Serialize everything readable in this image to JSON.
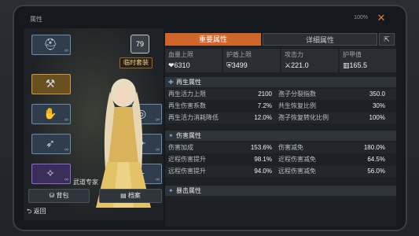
{
  "title": "属性",
  "battery": "100%",
  "level": "79",
  "temp_suit": "临时套装",
  "expert": "武道专家",
  "buttons": {
    "bag": "背包",
    "archive": "档案",
    "back": "返回"
  },
  "tabs": [
    "重要属性",
    "详细属性"
  ],
  "top_stats": [
    {
      "label": "血量上限",
      "value": "6310",
      "icon": "heart-icon"
    },
    {
      "label": "护盾上限",
      "value": "3499",
      "icon": "shield-icon"
    },
    {
      "label": "攻击力",
      "value": "221.0",
      "icon": "sword-icon"
    },
    {
      "label": "护甲值",
      "value": "165.5",
      "icon": "armor-icon"
    }
  ],
  "sections": [
    {
      "title": "再生属性",
      "rows": [
        [
          "再生活力上限",
          "2100",
          "孢子分裂指数",
          "350.0"
        ],
        [
          "再生伤害系数",
          "7.2%",
          "共生恢复比例",
          "30%"
        ],
        [
          "再生活力消耗降低",
          "12.0%",
          "孢子恢复转化比例",
          "100%"
        ]
      ]
    },
    {
      "title": "伤害属性",
      "rows": [
        [
          "伤害加成",
          "153.6%",
          "伤害减免",
          "180.0%"
        ],
        [
          "近程伤害提升",
          "98.1%",
          "近程伤害减免",
          "64.5%"
        ],
        [
          "远程伤害提升",
          "94.0%",
          "远程伤害减免",
          "56.0%"
        ]
      ]
    },
    {
      "title": "暴击属性",
      "rows": []
    }
  ]
}
